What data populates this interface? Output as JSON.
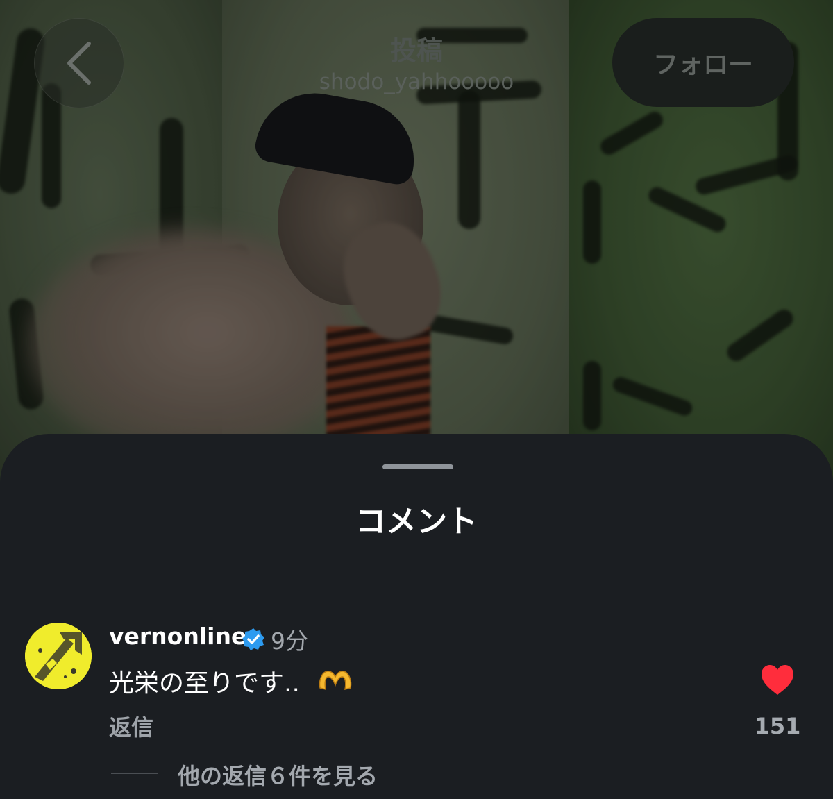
{
  "header": {
    "title": "投稿",
    "subtitle": "shodo_yahhooooo",
    "back_icon": "chevron-left-icon",
    "follow_label": "フォロー"
  },
  "sheet": {
    "title": "コメント"
  },
  "comment": {
    "username": "vernonline",
    "verified_icon": "verified-badge-icon",
    "time": "9分",
    "text": "光栄の至りです..",
    "emoji": "heart-hands-emoji",
    "reply_label": "返信",
    "like_icon": "heart-icon",
    "like_count": "151",
    "more_replies_label": "他の返信６件を見る"
  },
  "colors": {
    "sheet_bg": "#1b1e22",
    "like_red": "#ff2d3c",
    "verified_blue": "#2d9bf0",
    "avatar_yellow": "#f0ec2c",
    "secondary_text": "#a3a8ae"
  }
}
